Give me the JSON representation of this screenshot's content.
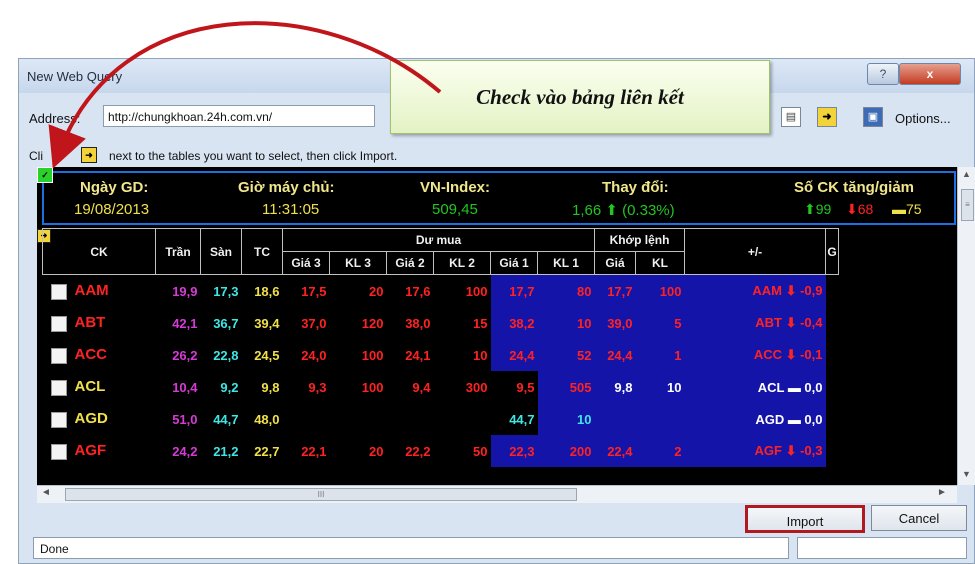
{
  "window": {
    "title": "New Web Query",
    "help_glyph": "?",
    "close_glyph": "x"
  },
  "address": {
    "label": "Address:",
    "value": "http://chungkhoan.24h.com.vn/"
  },
  "toolbar": {
    "page_icon_glyph": "▤",
    "arrow_icon_glyph": "➜",
    "save_icon_glyph": "▣",
    "options_label": "Options..."
  },
  "instruction": {
    "prefix": "Cli",
    "icon_glyph": "➜",
    "text": "next to the tables you want to select, then click Import."
  },
  "callout": {
    "text": "Check vào bảng liên kết"
  },
  "summary": {
    "labels": {
      "date": "Ngày GD:",
      "server_time": "Giờ máy chủ:",
      "index": "VN-Index:",
      "change": "Thay đổi:",
      "count": "Số CK tăng/giảm"
    },
    "values": {
      "date": "19/08/2013",
      "server_time": "11:31:05",
      "index": "509,45",
      "change": "1,66 ⬆ (0.33%)",
      "up": "⬆99",
      "down": "⬇68",
      "flat": "▬75"
    }
  },
  "table": {
    "headers": {
      "ck": "CK",
      "tran": "Trần",
      "san": "Sàn",
      "tc": "TC",
      "du_mua": "Dư mua",
      "khop_lenh": "Khớp lệnh",
      "change": "+/-",
      "gia3": "Giá 3",
      "kl3": "KL 3",
      "gia2": "Giá 2",
      "kl2": "KL 2",
      "gia1": "Giá 1",
      "kl1": "KL 1",
      "gia": "Giá",
      "kl": "KL",
      "next": "G"
    },
    "rows": [
      {
        "ck": "AAM",
        "tran": "19,9",
        "san": "17,3",
        "tc": "18,6",
        "gia3": "17,5",
        "kl3": "20",
        "gia2": "17,6",
        "kl2": "100",
        "gia1": "17,7",
        "kl1": "80",
        "gia": "17,7",
        "kl": "100",
        "change": "AAM ⬇ -0,9",
        "trend": "dn",
        "kgcolor": "dn"
      },
      {
        "ck": "ABT",
        "tran": "42,1",
        "san": "36,7",
        "tc": "39,4",
        "gia3": "37,0",
        "kl3": "120",
        "gia2": "38,0",
        "kl2": "15",
        "gia1": "38,2",
        "kl1": "10",
        "gia": "39,0",
        "kl": "5",
        "change": "ABT ⬇ -0,4",
        "trend": "dn",
        "kgcolor": "dn"
      },
      {
        "ck": "ACC",
        "tran": "26,2",
        "san": "22,8",
        "tc": "24,5",
        "gia3": "24,0",
        "kl3": "100",
        "gia2": "24,1",
        "kl2": "10",
        "gia1": "24,4",
        "kl1": "52",
        "gia": "24,4",
        "kl": "1",
        "change": "ACC ⬇ -0,1",
        "trend": "dn",
        "kgcolor": "dn"
      },
      {
        "ck": "ACL",
        "tran": "10,4",
        "san": "9,2",
        "tc": "9,8",
        "gia3": "9,3",
        "kl3": "100",
        "gia2": "9,4",
        "kl2": "300",
        "gia1": "9,5",
        "kl1": "505",
        "gia": "9,8",
        "kl": "10",
        "change": "ACL ▬ 0,0",
        "trend": "fl",
        "kgcolor": "wh"
      },
      {
        "ck": "AGD",
        "tran": "51,0",
        "san": "44,7",
        "tc": "48,0",
        "gia3": "",
        "kl3": "",
        "gia2": "",
        "kl2": "",
        "gia1": "44,7",
        "kl1": "10",
        "gia": "",
        "kl": "",
        "change": "AGD ▬ 0,0",
        "trend": "fl",
        "kgcolor": "wh"
      },
      {
        "ck": "AGF",
        "tran": "24,2",
        "san": "21,2",
        "tc": "22,7",
        "gia3": "22,1",
        "kl3": "20",
        "gia2": "22,2",
        "kl2": "50",
        "gia1": "22,3",
        "kl1": "200",
        "gia": "22,4",
        "kl": "2",
        "change": "AGF ⬇ -0,3",
        "trend": "dn",
        "kgcolor": "dn"
      }
    ]
  },
  "scroll": {
    "up_glyph": "▲",
    "down_glyph": "▼",
    "left_glyph": "◄",
    "right_glyph": "►",
    "grip_glyph": "≡",
    "hgrip_glyph": "III"
  },
  "buttons": {
    "import": "Import",
    "cancel": "Cancel"
  },
  "status": {
    "text": "Done"
  }
}
